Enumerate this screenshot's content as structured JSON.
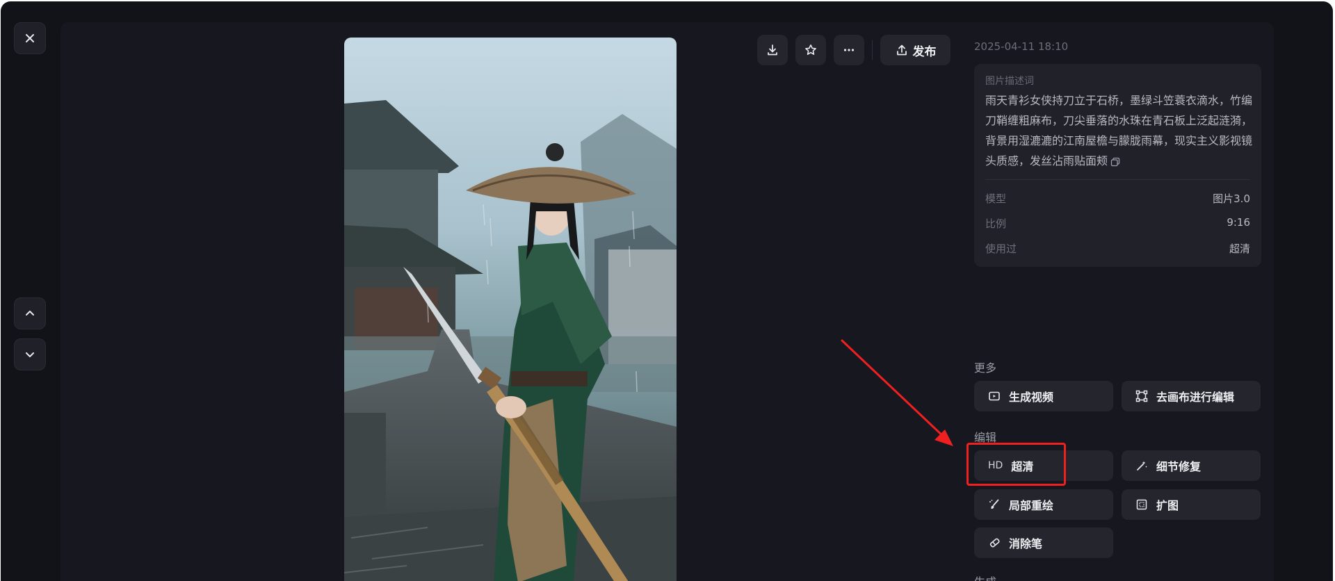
{
  "window": {
    "close_icon": "close-icon",
    "nav_up_icon": "chevron-up-icon",
    "nav_down_icon": "chevron-down-icon"
  },
  "toolbar": {
    "download_icon": "download-icon",
    "favorite_icon": "star-icon",
    "more_icon": "more-icon",
    "publish_label": "发布",
    "publish_icon": "upload-icon"
  },
  "image": {
    "alt": "雨天青衫女侠持刀立于石桥"
  },
  "details": {
    "timestamp": "2025-04-11 18:10",
    "prompt_label": "图片描述词",
    "prompt_text": "雨天青衫女侠持刀立于石桥，墨绿斗笠蓑衣滴水，竹编刀鞘缠粗麻布，刀尖垂落的水珠在青石板上泛起涟漪，背景用湿漉漉的江南屋檐与朦胧雨幕，现实主义影视镜头质感，发丝沾雨贴面颊",
    "copy_icon": "copy-icon",
    "meta": [
      {
        "key": "模型",
        "value": "图片3.0"
      },
      {
        "key": "比例",
        "value": "9:16"
      },
      {
        "key": "使用过",
        "value": "超清"
      }
    ]
  },
  "more_section": {
    "title": "更多",
    "buttons": [
      {
        "label": "生成视频",
        "icon": "video-generate-icon"
      },
      {
        "label": "去画布进行编辑",
        "icon": "canvas-edit-icon"
      }
    ]
  },
  "edit_section": {
    "title": "编辑",
    "buttons": [
      {
        "label": "超清",
        "icon": "hd-icon",
        "icon_text": "HD"
      },
      {
        "label": "细节修复",
        "icon": "magic-wand-icon"
      },
      {
        "label": "局部重绘",
        "icon": "inpaint-brush-icon"
      },
      {
        "label": "扩图",
        "icon": "expand-frame-icon"
      },
      {
        "label": "消除笔",
        "icon": "eraser-icon"
      }
    ]
  },
  "generate_section": {
    "title": "生成"
  },
  "annotation": {
    "color": "#f02020"
  }
}
